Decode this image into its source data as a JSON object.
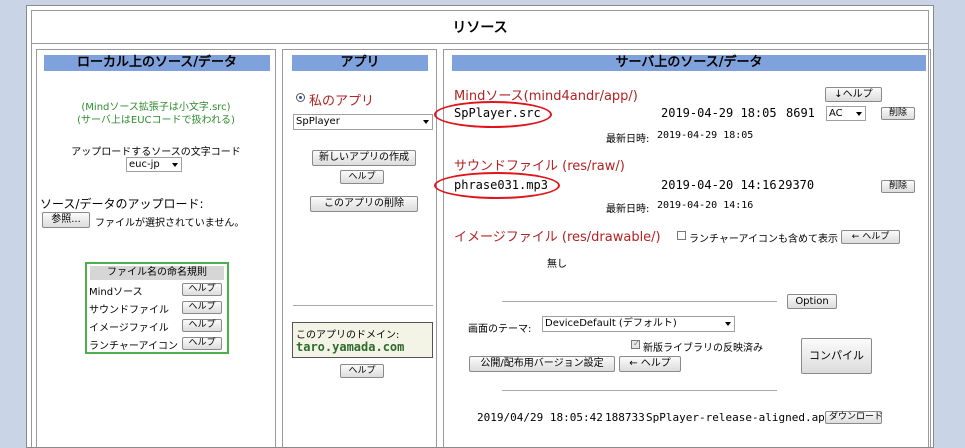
{
  "page": {
    "title": "リソース"
  },
  "local": {
    "header": "ローカル上のソース/データ",
    "note1": "(Mindソース拡張子は小文字.src)",
    "note2": "(サーバ上はEUCコードで扱われる)",
    "encoding_label": "アップロードするソースの文字コード",
    "encoding_value": "euc-jp",
    "upload_label": "ソース/データのアップロード:",
    "browse_button": "参照...",
    "no_file_text": "ファイルが選択されていません。",
    "naming": {
      "title": "ファイル名の命名規則",
      "rows": [
        {
          "label": "Mindソース",
          "help": "ヘルプ"
        },
        {
          "label": "サウンドファイル",
          "help": "ヘルプ"
        },
        {
          "label": "イメージファイル",
          "help": "ヘルプ"
        },
        {
          "label": "ランチャーアイコン",
          "help": "ヘルプ"
        }
      ]
    }
  },
  "app": {
    "header": "アプリ",
    "my_app_label": "私のアプリ",
    "app_select_value": "SpPlayer",
    "new_app_button": "新しいアプリの作成",
    "help_button": "ヘルプ",
    "delete_app_button": "このアプリの削除",
    "domain_label": "このアプリのドメイン:",
    "domain_value": "taro.yamada.com",
    "domain_help_button": "ヘルプ"
  },
  "server": {
    "header": "サーバ上のソース/データ",
    "mind": {
      "section_title": "Mindソース(mind4andr/app/)",
      "help_button": "↓ヘルプ",
      "file_name": "SpPlayer.src",
      "date": "2019-04-29 18:05",
      "size": "8691",
      "encoding_value": "AC",
      "delete_button": "削除",
      "latest_label": "最新日時:",
      "latest_value": "2019-04-29 18:05"
    },
    "sound": {
      "section_title": "サウンドファイル (res/raw/)",
      "file_name": "phrase031.mp3",
      "date": "2019-04-20 14:16",
      "size": "29370",
      "delete_button": "削除",
      "latest_label": "最新日時:",
      "latest_value": "2019-04-20 14:16"
    },
    "image": {
      "section_title": "イメージファイル (res/drawable/)",
      "launcher_checkbox_label": "ランチャーアイコンも含めて表示",
      "help_button": "← ヘルプ",
      "none_text": "無し"
    },
    "option_button": "Option",
    "theme_label": "画面のテーマ:",
    "theme_value": "DeviceDefault (デフォルト)",
    "newlib_label": "新版ライブラリの反映済み",
    "publish_button": "公開/配布用バージョン設定",
    "publish_help_button": "← ヘルプ",
    "compile_button": "コンパイル",
    "apk": {
      "datetime": "2019/04/29 18:05:42",
      "size": "188733",
      "file_name": "SpPlayer-release-aligned.apk",
      "download_button": "ダウンロード"
    }
  }
}
